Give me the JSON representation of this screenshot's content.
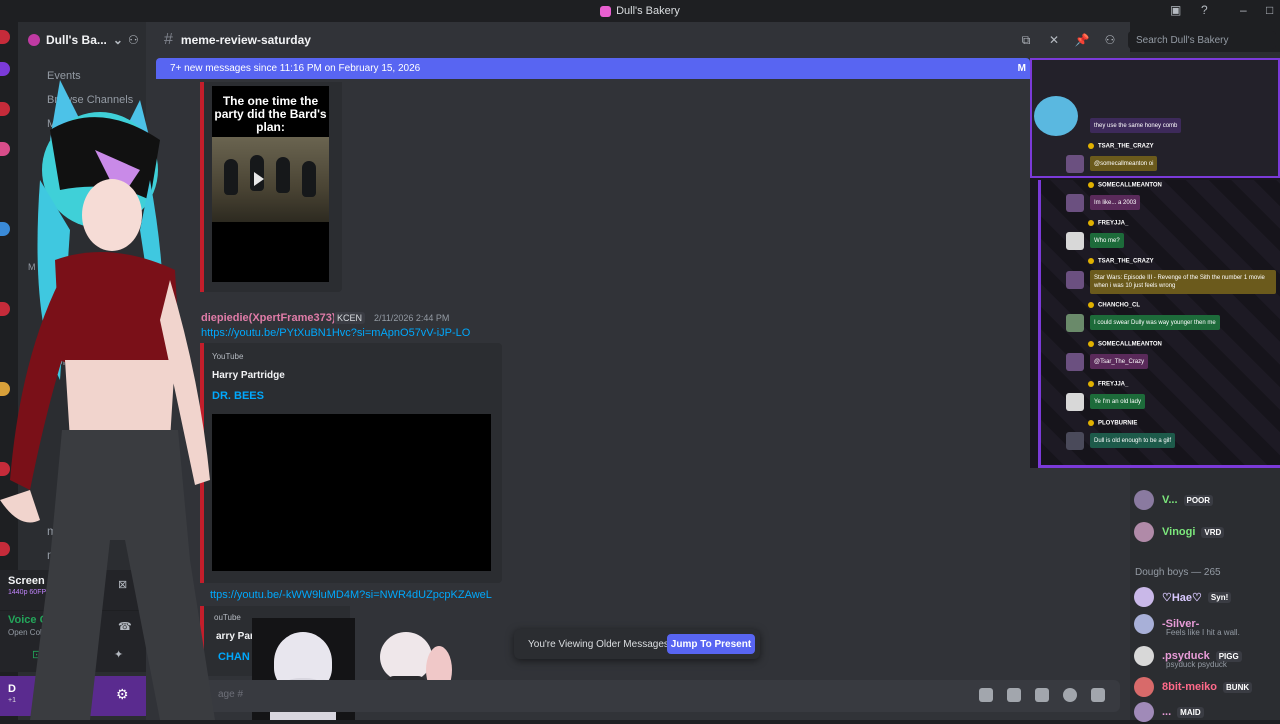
{
  "window": {
    "title": "Dull's Bakery"
  },
  "server": {
    "name": "Dull's Ba..."
  },
  "sidebar": {
    "items": [
      {
        "label": "Events"
      },
      {
        "label": "Browse Channels"
      },
      {
        "label": "Me"
      }
    ],
    "channels": [
      {
        "label": "ai"
      },
      {
        "label": "e6-le"
      },
      {
        "label": "orld"
      },
      {
        "label": "m"
      },
      {
        "label": "mu"
      }
    ],
    "category": "M"
  },
  "screen_share": {
    "label": "Screen 2",
    "sub": "1440p 60FPS"
  },
  "voice": {
    "label": "Voice Cor",
    "sub": "Open Collab"
  },
  "user": {
    "name": "D",
    "status": "+1"
  },
  "channel": {
    "name": "meme-review-saturday"
  },
  "new_messages_bar": {
    "text": "7+ new messages since 11:16 PM on February 15, 2026",
    "mark_read": "M"
  },
  "search": {
    "placeholder": "Search Dull's Bakery"
  },
  "meme": {
    "caption": "The one time the party did the Bard's plan:"
  },
  "message": {
    "author": "diepiedie(XpertFrame373)",
    "badge": "KCEN",
    "timestamp": "2/11/2026 2:44 PM",
    "link": "https://youtu.be/PYtXuBN1Hvc?si=mApnO57vV-iJP-LO",
    "embed": {
      "provider": "YouTube",
      "author": "Harry Partridge",
      "title": "DR. BEES"
    }
  },
  "message2": {
    "link": "ttps://youtu.be/-kWW9luMD4M?si=NWR4dUZpcpKZAweL",
    "embed": {
      "provider": "ouTube",
      "author": "arry Par",
      "title": "CHAN"
    }
  },
  "older_messages": {
    "text": "You're Viewing Older Messages",
    "jump": "Jump To Present"
  },
  "composer": {
    "placeholder": "age #"
  },
  "overlay_chat": [
    {
      "name": "",
      "msg": "they use the same honey comb",
      "color": "#3d2a5a"
    },
    {
      "name": "TSAR_THE_CRAZY",
      "msg": "@somecallmeanton oi",
      "color": "#6b5a1c"
    },
    {
      "name": "SOMECALLMEANTON",
      "msg": "Im like... a 2003",
      "color": "#5a2a5a"
    },
    {
      "name": "FREYJJA_",
      "msg": "Who me?",
      "color": "#1d6b3a"
    },
    {
      "name": "TSAR_THE_CRAZY",
      "msg": "Star Wars: Episode III - Revenge of the Sith the number 1 movie when i was 10 just feels wrong",
      "color": "#6b5a1c"
    },
    {
      "name": "CHANCHO_CL",
      "msg": "I could swear Dully was way younger then me",
      "color": "#1d6b3a"
    },
    {
      "name": "SOMECALLMEANTON",
      "msg": "@Tsar_The_Crazy",
      "color": "#5a2a5a"
    },
    {
      "name": "FREYJJA_",
      "msg": "Ye I'm an old lady",
      "color": "#1d6b3a"
    },
    {
      "name": "PLOYBURNIE",
      "msg": "Dull is old enough to be a gilf",
      "color": "#1d5a4a"
    }
  ],
  "members": {
    "items": [
      {
        "name": "V...",
        "tag": "POOR",
        "color": "#7ce87c"
      },
      {
        "name": "Vinogi",
        "tag": "VRD",
        "color": "#7ce87c"
      }
    ],
    "group": "Dough boys — 265",
    "group_items": [
      {
        "name": "♡Hae♡",
        "tag": "Syn!",
        "color": "#d9c9ff",
        "sub": ""
      },
      {
        "name": "-Silver-",
        "tag": "",
        "color": "#e89cd8",
        "sub": "Feels like I hit a wall."
      },
      {
        "name": ".psyduck",
        "tag": "PIGG",
        "color": "#e89cd8",
        "sub": "psyduck psyduck"
      },
      {
        "name": "8bit-meiko",
        "tag": "BUNK",
        "color": "#ff6a8a",
        "sub": ""
      },
      {
        "name": "...",
        "tag": "MAID",
        "color": "#e89cd8",
        "sub": ""
      }
    ]
  }
}
